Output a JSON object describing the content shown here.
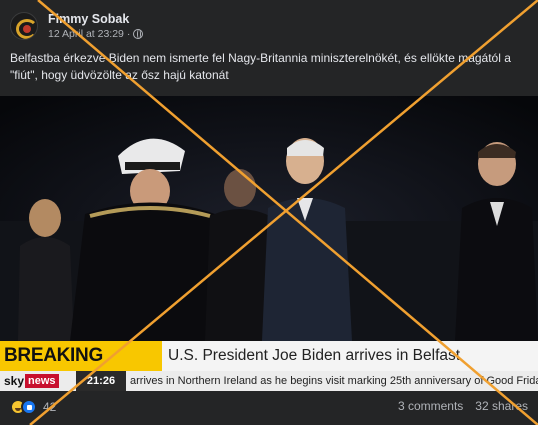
{
  "post": {
    "author": "Fimmy Sobak",
    "date": "12 April at 23:29",
    "separator": "·",
    "caption": "Belfastba érkezve Biden nem ismerte fel Nagy-Britannia miniszterelnökét, és ellökte magától a \"fiút\", hogy üdvözölte  az ősz hajú katonát"
  },
  "video": {
    "breaking_label": "BREAKING NEWS",
    "headline": "U.S. President Joe Biden arrives in Belfast",
    "channel_sky": "sky",
    "channel_news": "news",
    "clock": "21:26",
    "ticker": "arrives in Northern Ireland as he begins visit marking 25th anniversary of Good Frida"
  },
  "footer": {
    "reaction_count": "42",
    "comments": "3 comments",
    "shares": "32 shares"
  },
  "colors": {
    "background": "#242526",
    "breaking_yellow": "#f8c700",
    "sky_red": "#c8102e",
    "cross_orange": "#f0a030"
  },
  "icons": [
    "globe-icon",
    "haha-reaction-icon",
    "like-reaction-icon"
  ]
}
